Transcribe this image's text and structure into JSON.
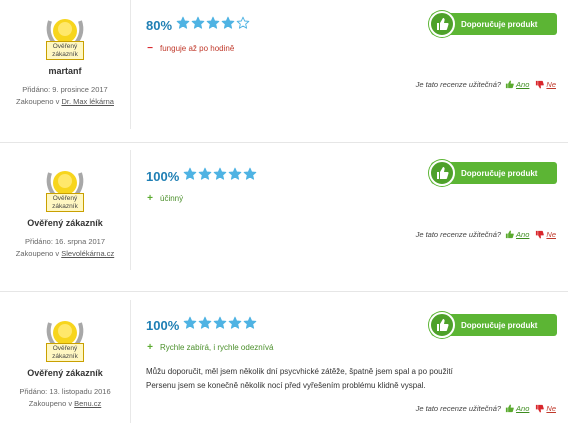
{
  "colors": {
    "accent": "#1f7fb4",
    "star": "#4fb3e3",
    "recommend": "#5cb534",
    "negative": "#d9262c",
    "positive": "#5aaa2e"
  },
  "common": {
    "badge_label_line1": "Ověřený",
    "badge_label_line2": "zákazník",
    "recommend_label": "Doporučuje produkt",
    "helpful_question": "Je tato recenze užitečná?",
    "yes": "Ano",
    "no": "Ne"
  },
  "reviews": [
    {
      "author": "martanf",
      "added": "Přidáno: 9. prosince 2017",
      "bought_prefix": "Zakoupeno v ",
      "shop": "Dr. Max lékárna",
      "rating_pct": "80%",
      "rating_stars": 4,
      "points": [
        {
          "type": "neg",
          "sign": "−",
          "text": "funguje až po hodině"
        }
      ],
      "text": []
    },
    {
      "author": "Ověřený zákazník",
      "added": "Přidáno: 16. srpna 2017",
      "bought_prefix": "Zakoupeno v ",
      "shop": "Slevolékárna.cz",
      "rating_pct": "100%",
      "rating_stars": 5,
      "points": [
        {
          "type": "pos",
          "sign": "+",
          "text": "účinný"
        }
      ],
      "text": []
    },
    {
      "author": "Ověřený zákazník",
      "added": "Přidáno: 13. listopadu 2016",
      "bought_prefix": "Zakoupeno v ",
      "shop": "Benu.cz",
      "rating_pct": "100%",
      "rating_stars": 5,
      "points": [
        {
          "type": "pos",
          "sign": "+",
          "text": "Rychle zabírá, i rychle odeznívá"
        }
      ],
      "text": [
        "Můžu doporučit, měl jsem několik dní psycvhické zátěže, špatně jsem spal a po použití",
        "Persenu jsem se konečně několik nocí před vyřešením problému klidně vyspal."
      ]
    }
  ]
}
